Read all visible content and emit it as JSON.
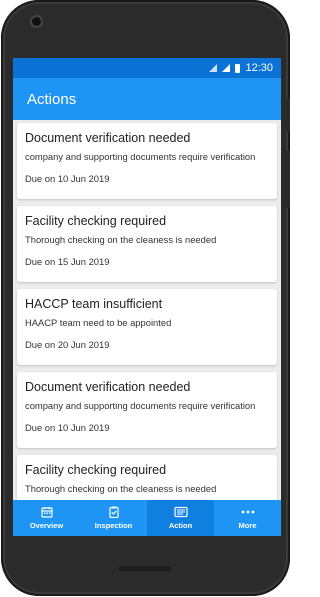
{
  "status_bar": {
    "time": "12:30"
  },
  "app_bar": {
    "title": "Actions"
  },
  "actions": [
    {
      "title": "Document verification needed",
      "description": "company and supporting documents require verification",
      "due": "Due on 10 Jun 2019"
    },
    {
      "title": "Facility checking required",
      "description": "Thorough checking on the cleaness is needed",
      "due": "Due on 15 Jun 2019"
    },
    {
      "title": "HACCP team insufficient",
      "description": "HAACP team need to be appointed",
      "due": "Due on 20 Jun 2019"
    },
    {
      "title": "Document verification needed",
      "description": "company and supporting documents require verification",
      "due": "Due on 10 Jun 2019"
    },
    {
      "title": "Facility checking required",
      "description": "Thorough checking on the cleaness is needed",
      "due": ""
    }
  ],
  "bottom_nav": [
    {
      "label": "Overview",
      "icon": "calendar-icon"
    },
    {
      "label": "Inspection",
      "icon": "clipboard-check-icon"
    },
    {
      "label": "Action",
      "icon": "list-card-icon",
      "active": true
    },
    {
      "label": "More",
      "icon": "more-dots-icon"
    }
  ],
  "colors": {
    "primary": "#1e95f5",
    "status_bar": "#0b72d6",
    "background": "#ececec"
  }
}
